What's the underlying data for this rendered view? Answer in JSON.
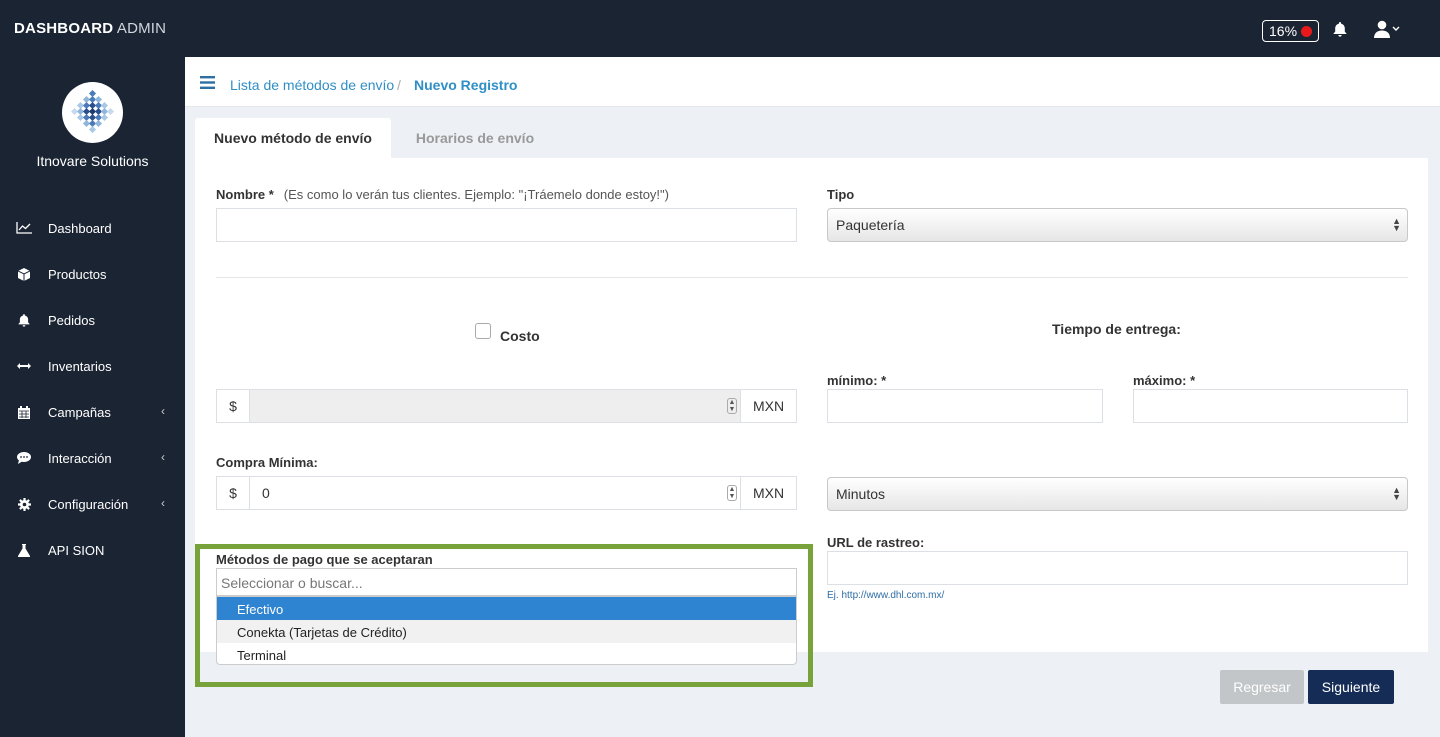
{
  "topbar": {
    "brand_bold": "DASHBOARD",
    "brand_light": "ADMIN",
    "percent": "16%",
    "status_color": "#e8191a"
  },
  "sidebar": {
    "company": "Itnovare Solutions",
    "items": [
      {
        "label": "Dashboard",
        "icon": "chart-line-icon"
      },
      {
        "label": "Productos",
        "icon": "cube-icon"
      },
      {
        "label": "Pedidos",
        "icon": "bell-icon"
      },
      {
        "label": "Inventarios",
        "icon": "arrows-horizontal-icon"
      },
      {
        "label": "Campañas",
        "icon": "calendar-icon",
        "expandable": true
      },
      {
        "label": "Interacción",
        "icon": "comment-icon",
        "expandable": true
      },
      {
        "label": "Configuración",
        "icon": "gear-icon",
        "expandable": true
      },
      {
        "label": "API SION",
        "icon": "flask-icon"
      }
    ]
  },
  "breadcrumb": {
    "parent": "Lista de métodos de envío",
    "separator": "/",
    "current": "Nuevo Registro"
  },
  "tabs": [
    {
      "label": "Nuevo método de envío"
    },
    {
      "label": "Horarios de envío"
    }
  ],
  "form": {
    "nombre_label": "Nombre *",
    "nombre_hint": "(Es como lo verán tus clientes. Ejemplo: \"¡Tráemelo donde estoy!\")",
    "tipo_label": "Tipo",
    "tipo_value": "Paquetería",
    "costo_label": "Costo",
    "currency_symbol": "$",
    "currency": "MXN",
    "tiempo_label": "Tiempo de entrega:",
    "minimo_label": "mínimo: *",
    "maximo_label": "máximo: *",
    "compra_label": "Compra Mínima:",
    "compra_value": "0",
    "unidad_value": "Minutos",
    "url_label": "URL de rastreo:",
    "url_hint": "Ej. http://www.dhl.com.mx/",
    "metodos_label": "Métodos de pago que se aceptaran",
    "metodos_placeholder": "Seleccionar o buscar...",
    "metodos_options": [
      "Efectivo",
      "Conekta (Tarjetas de Crédito)",
      "Terminal"
    ]
  },
  "actions": {
    "back": "Regresar",
    "next": "Siguiente"
  },
  "colors": {
    "sidebar": "#1b2433",
    "accent": "#2f8fc5",
    "primary_button": "#152c57",
    "highlight": "#78a23a",
    "selected_option": "#2f84d1"
  }
}
